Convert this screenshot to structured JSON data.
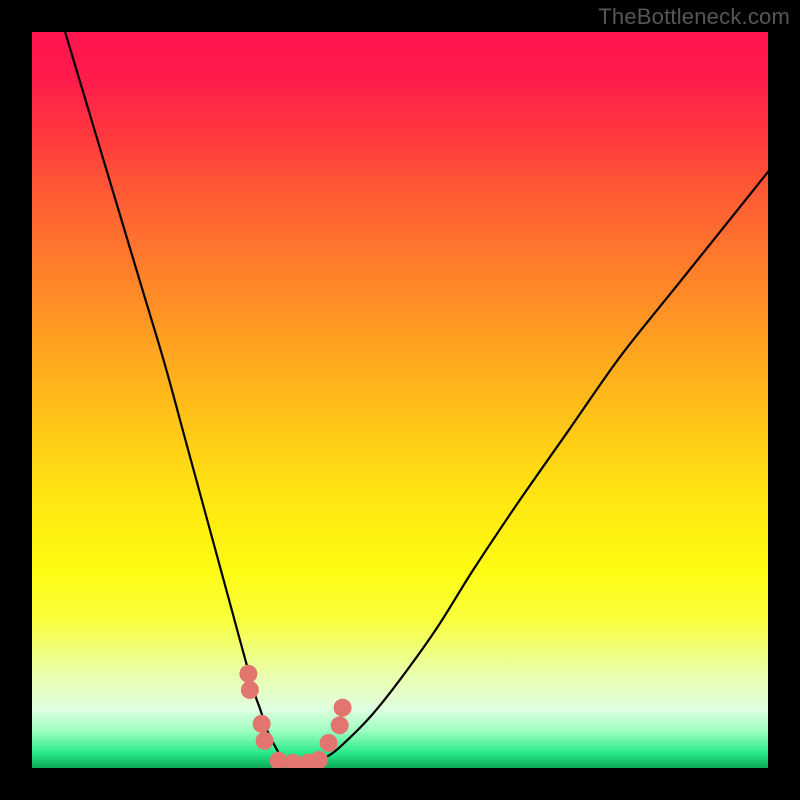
{
  "watermark": "TheBottleneck.com",
  "chart_data": {
    "type": "line",
    "title": "",
    "xlabel": "",
    "ylabel": "",
    "xlim": [
      0,
      100
    ],
    "ylim": [
      0,
      100
    ],
    "series": [
      {
        "name": "bottleneck-curve",
        "x": [
          0,
          3,
          6,
          9,
          12,
          15,
          18,
          21,
          24,
          27,
          30,
          31,
          32,
          33,
          34,
          36,
          38,
          40,
          42,
          46,
          50,
          55,
          60,
          66,
          73,
          80,
          88,
          96,
          100
        ],
        "values": [
          115,
          105,
          95,
          85,
          75,
          65,
          55,
          44,
          33,
          22,
          11,
          8,
          5,
          3,
          1.5,
          0.7,
          0.7,
          1.5,
          3,
          7,
          12,
          19,
          27,
          36,
          46,
          56,
          66,
          76,
          81
        ]
      }
    ],
    "markers": {
      "name": "valley-points",
      "color": "#e2766f",
      "radius_px": 9,
      "x": [
        29.4,
        29.6,
        31.2,
        31.6,
        33.5,
        35.5,
        37.5,
        39.0,
        40.3,
        41.8,
        42.2
      ],
      "values": [
        12.8,
        10.6,
        6.0,
        3.7,
        1.0,
        0.7,
        0.7,
        1.1,
        3.4,
        5.8,
        8.2
      ]
    },
    "gradient_stops": [
      {
        "pct": 0,
        "color": "#ff1450"
      },
      {
        "pct": 50,
        "color": "#ffd018"
      },
      {
        "pct": 78,
        "color": "#fffb12"
      },
      {
        "pct": 100,
        "color": "#0ea858"
      }
    ]
  }
}
